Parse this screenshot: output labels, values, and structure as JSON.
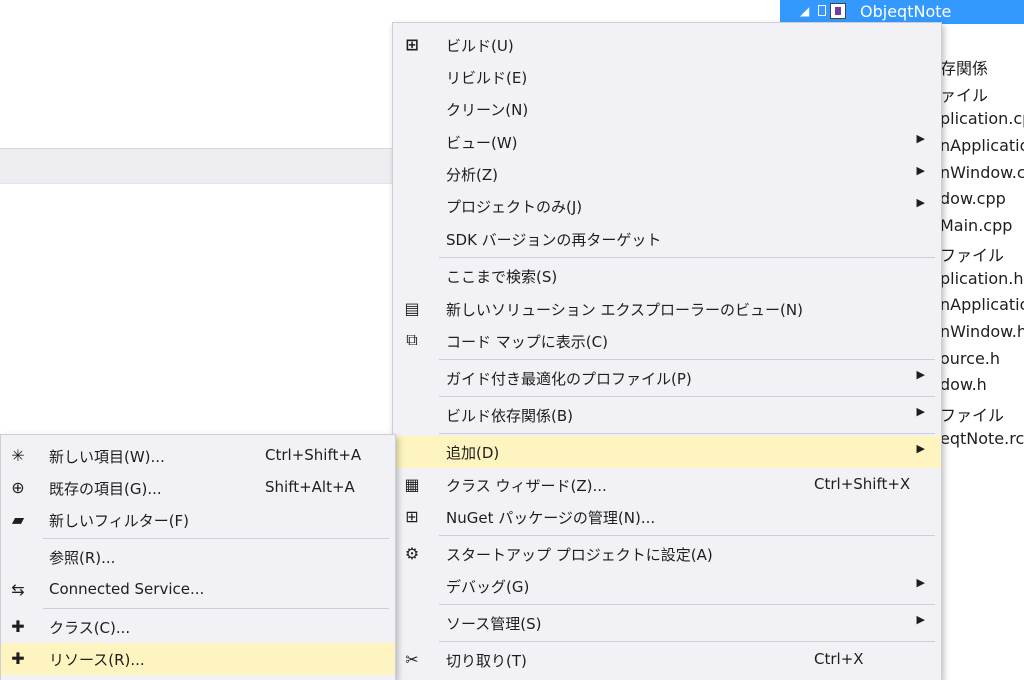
{
  "solution_explorer": {
    "project_label": "ObjeqtNote",
    "items": [
      "存関係",
      "ァイル",
      "plication.cpp",
      "nApplication",
      "nWindow.cpp",
      "dow.cpp",
      "Main.cpp",
      "ファイル",
      "plication.h",
      "nApplication",
      "nWindow.h",
      "ource.h",
      "dow.h",
      "ファイル",
      "eqtNote.rc"
    ]
  },
  "context_menu": {
    "items": [
      {
        "label": "ビルド(U)",
        "icon": "build-icon",
        "shortcut": "",
        "submenu": false
      },
      {
        "label": "リビルド(E)",
        "icon": "",
        "shortcut": "",
        "submenu": false
      },
      {
        "label": "クリーン(N)",
        "icon": "",
        "shortcut": "",
        "submenu": false
      },
      {
        "label": "ビュー(W)",
        "icon": "",
        "shortcut": "",
        "submenu": true
      },
      {
        "label": "分析(Z)",
        "icon": "",
        "shortcut": "",
        "submenu": true
      },
      {
        "label": "プロジェクトのみ(J)",
        "icon": "",
        "shortcut": "",
        "submenu": true
      },
      {
        "label": "SDK バージョンの再ターゲット",
        "icon": "",
        "shortcut": "",
        "submenu": false
      },
      {
        "label": "ここまで検索(S)",
        "icon": "",
        "shortcut": "",
        "submenu": false
      },
      {
        "label": "新しいソリューション エクスプローラーのビュー(N)",
        "icon": "new-view-icon",
        "shortcut": "",
        "submenu": false
      },
      {
        "label": "コード マップに表示(C)",
        "icon": "code-map-icon",
        "shortcut": "",
        "submenu": false
      },
      {
        "label": "ガイド付き最適化のプロファイル(P)",
        "icon": "",
        "shortcut": "",
        "submenu": true
      },
      {
        "label": "ビルド依存関係(B)",
        "icon": "",
        "shortcut": "",
        "submenu": true
      },
      {
        "label": "追加(D)",
        "icon": "",
        "shortcut": "",
        "submenu": true
      },
      {
        "label": "クラス ウィザード(Z)...",
        "icon": "class-wizard-icon",
        "shortcut": "Ctrl+Shift+X",
        "submenu": false
      },
      {
        "label": "NuGet パッケージの管理(N)...",
        "icon": "nuget-icon",
        "shortcut": "",
        "submenu": false
      },
      {
        "label": "スタートアップ プロジェクトに設定(A)",
        "icon": "gear-icon",
        "shortcut": "",
        "submenu": false
      },
      {
        "label": "デバッグ(G)",
        "icon": "",
        "shortcut": "",
        "submenu": true
      },
      {
        "label": "ソース管理(S)",
        "icon": "",
        "shortcut": "",
        "submenu": true
      },
      {
        "label": "切り取り(T)",
        "icon": "scissors-icon",
        "shortcut": "Ctrl+X",
        "submenu": false
      }
    ]
  },
  "add_submenu": {
    "items": [
      {
        "label": "新しい項目(W)...",
        "icon": "new-item-icon",
        "shortcut": "Ctrl+Shift+A"
      },
      {
        "label": "既存の項目(G)...",
        "icon": "existing-item-icon",
        "shortcut": "Shift+Alt+A"
      },
      {
        "label": "新しいフィルター(F)",
        "icon": "new-filter-icon",
        "shortcut": ""
      },
      {
        "label": "参照(R)...",
        "icon": "",
        "shortcut": ""
      },
      {
        "label": "Connected Service...",
        "icon": "connected-service-icon",
        "shortcut": ""
      },
      {
        "label": "クラス(C)...",
        "icon": "add-class-icon",
        "shortcut": ""
      },
      {
        "label": "リソース(R)...",
        "icon": "add-resource-icon",
        "shortcut": ""
      }
    ]
  },
  "colors": {
    "highlight": "#fdf4bf",
    "menu_background": "#f2f2f6",
    "selection_blue": "#3399ff"
  }
}
